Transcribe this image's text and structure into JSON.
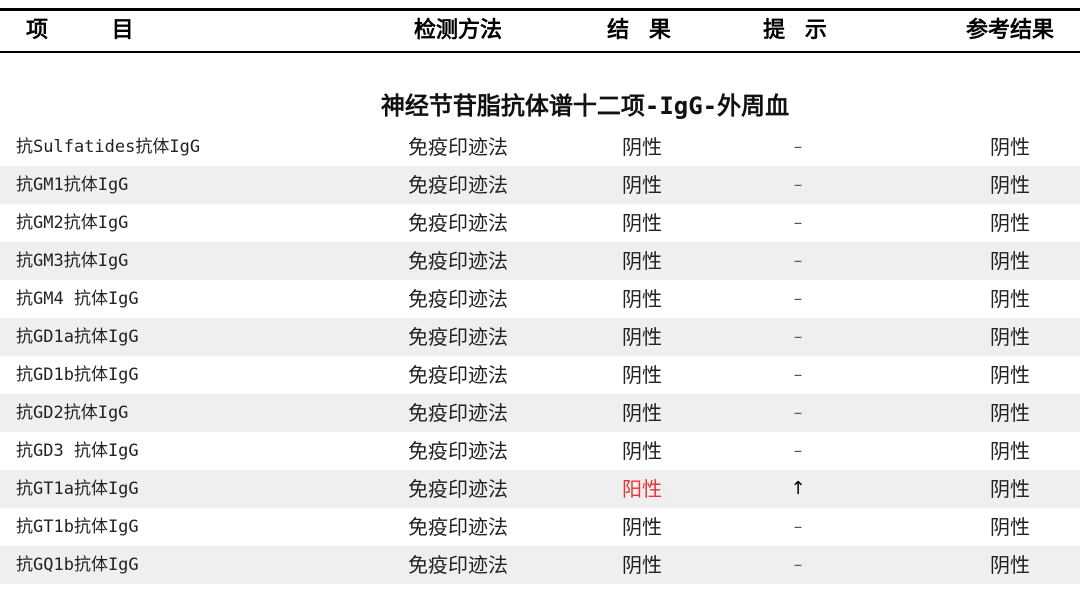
{
  "header": {
    "item": "项 目",
    "method": "检测方法",
    "result": "结 果",
    "hint": "提 示",
    "reference": "参考结果"
  },
  "section": {
    "title": "神经节苷脂抗体谱十二项-IgG-外周血"
  },
  "rows": [
    {
      "item": "抗Sulfatides抗体IgG",
      "method": "免疫印迹法",
      "result": "阴性",
      "hint": "–",
      "reference": "阴性"
    },
    {
      "item": "抗GM1抗体IgG",
      "method": "免疫印迹法",
      "result": "阴性",
      "hint": "–",
      "reference": "阴性"
    },
    {
      "item": "抗GM2抗体IgG",
      "method": "免疫印迹法",
      "result": "阴性",
      "hint": "–",
      "reference": "阴性"
    },
    {
      "item": "抗GM3抗体IgG",
      "method": "免疫印迹法",
      "result": "阴性",
      "hint": "–",
      "reference": "阴性"
    },
    {
      "item": "抗GM4 抗体IgG",
      "method": "免疫印迹法",
      "result": "阴性",
      "hint": "–",
      "reference": "阴性"
    },
    {
      "item": "抗GD1a抗体IgG",
      "method": "免疫印迹法",
      "result": "阴性",
      "hint": "–",
      "reference": "阴性"
    },
    {
      "item": "抗GD1b抗体IgG",
      "method": "免疫印迹法",
      "result": "阴性",
      "hint": "–",
      "reference": "阴性"
    },
    {
      "item": "抗GD2抗体IgG",
      "method": "免疫印迹法",
      "result": "阴性",
      "hint": "–",
      "reference": "阴性"
    },
    {
      "item": "抗GD3 抗体IgG",
      "method": "免疫印迹法",
      "result": "阴性",
      "hint": "–",
      "reference": "阴性"
    },
    {
      "item": "抗GT1a抗体IgG",
      "method": "免疫印迹法",
      "result": "阳性",
      "hint": "↑",
      "reference": "阴性"
    },
    {
      "item": "抗GT1b抗体IgG",
      "method": "免疫印迹法",
      "result": "阴性",
      "hint": "–",
      "reference": "阴性"
    },
    {
      "item": "抗GQ1b抗体IgG",
      "method": "免疫印迹法",
      "result": "阴性",
      "hint": "–",
      "reference": "阴性"
    }
  ],
  "colors": {
    "positive": "#e8343a",
    "stripe": "#efefef"
  }
}
